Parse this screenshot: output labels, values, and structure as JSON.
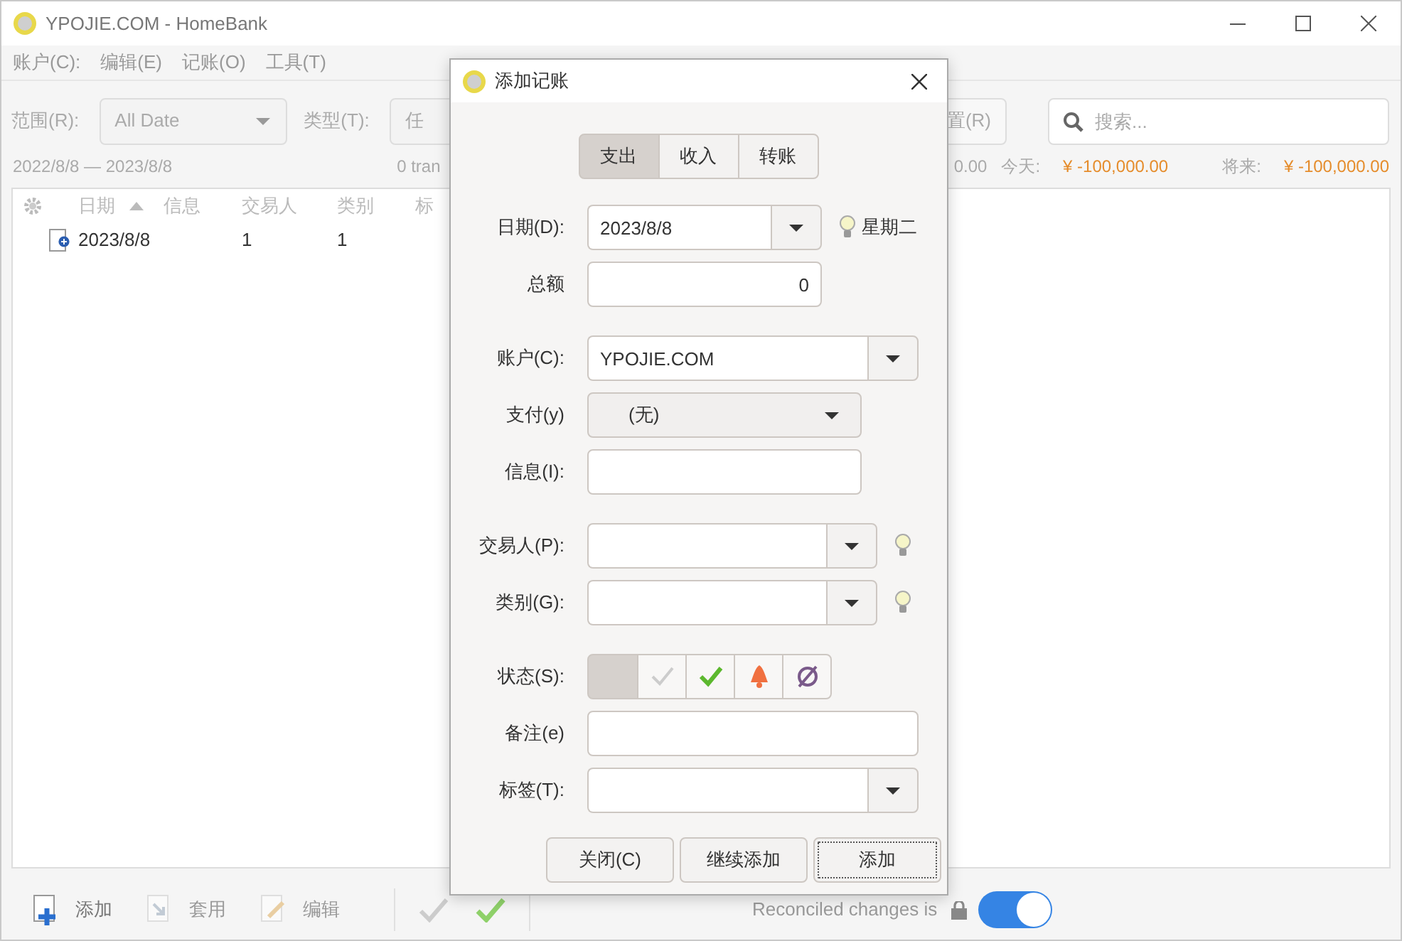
{
  "main_window": {
    "title": "YPOJIE.COM - HomeBank",
    "menu": [
      "账户(C):",
      "编辑(E)",
      "记账(O)",
      "工具(T)"
    ],
    "filters": [
      {
        "label": "范围(R):",
        "value": "All Date"
      },
      {
        "label": "类型(T):",
        "value": "任"
      }
    ],
    "reset_button": "置(R)",
    "search": {
      "placeholder": "搜索..."
    },
    "summary": {
      "date_range": "2022/8/8 — 2023/8/8",
      "count": "0 tran",
      "totals": [
        {
          "value": "0.00",
          "negative": false
        },
        {
          "label": "今天:",
          "value": "¥ -100,000.00",
          "negative": true
        },
        {
          "label": "将来:",
          "value": "¥ -100,000.00",
          "negative": true
        }
      ]
    },
    "table": {
      "columns": [
        {
          "label": "日期",
          "sorted": true
        },
        {
          "label": "信息",
          "sorted": false
        },
        {
          "label": "交易人",
          "sorted": false
        },
        {
          "label": "类别",
          "sorted": false
        },
        {
          "label": "标",
          "sorted": false
        }
      ],
      "rows": [
        {
          "cells": [
            "2023/8/8",
            null,
            "1",
            "1",
            null
          ]
        }
      ]
    },
    "toolbar": [
      {
        "label": "添加",
        "disabled": false
      },
      {
        "label": "套用",
        "disabled": true
      },
      {
        "label": "编辑",
        "disabled": true
      }
    ],
    "reconcile": {
      "label": "Reconciled changes is",
      "on": true
    }
  },
  "dialog": {
    "title": "添加记账",
    "type_tabs": [
      {
        "label": "支出",
        "selected": true
      },
      {
        "label": "收入",
        "selected": false
      },
      {
        "label": "转账",
        "selected": false
      }
    ],
    "groups": [
      [
        {
          "kind": "combo",
          "label": "日期(D):",
          "value": "2023/8/8",
          "bulb": true,
          "hint": "星期二"
        },
        {
          "kind": "entry",
          "label": "总额",
          "value": "0"
        }
      ],
      [
        {
          "kind": "combo",
          "label": "账户(C):",
          "value": "YPOJIE.COM"
        },
        {
          "kind": "select",
          "label": "支付(y)",
          "value": "(无)"
        },
        {
          "kind": "entry",
          "label": "信息(I):"
        }
      ],
      [
        {
          "kind": "combo",
          "label": "交易人(P):",
          "bulb": true
        },
        {
          "kind": "combo",
          "label": "类别(G):",
          "bulb": true
        }
      ],
      [
        {
          "kind": "status",
          "label": "状态(S):",
          "options": [
            {
              "kind": "none",
              "selected": true
            },
            {
              "kind": "cleared",
              "selected": false
            },
            {
              "kind": "reconciled",
              "selected": false
            },
            {
              "kind": "remind",
              "selected": false
            },
            {
              "kind": "void",
              "selected": false
            }
          ]
        },
        {
          "kind": "entry",
          "label": "备注(e)"
        },
        {
          "kind": "combo",
          "label": "标签(T):"
        }
      ]
    ],
    "buttons": [
      {
        "label": "关闭(C)",
        "default": false
      },
      {
        "label": "继续添加",
        "default": false
      },
      {
        "label": "添加",
        "default": true
      }
    ]
  }
}
